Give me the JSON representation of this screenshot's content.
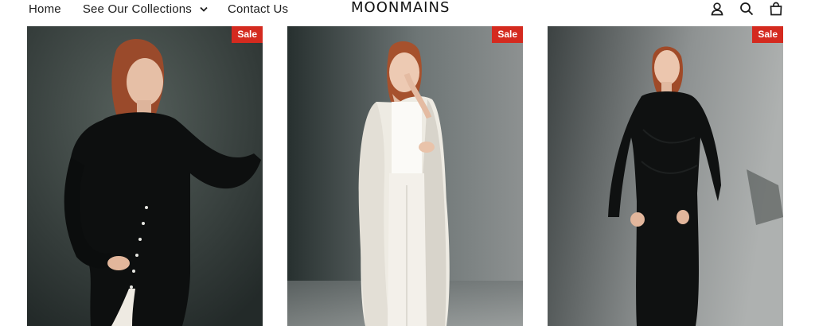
{
  "nav": {
    "home": "Home",
    "collections": "See Our Collections",
    "contact": "Contact Us"
  },
  "logo": "MOONMAINS",
  "header_icons": [
    "account-icon",
    "search-icon",
    "cart-icon"
  ],
  "products": [
    {
      "badge": "Sale",
      "image": "model in black long-sleeve dress with pearl buttons"
    },
    {
      "badge": "Sale",
      "image": "model in white cape and white trousers"
    },
    {
      "badge": "Sale",
      "image": "model in black long-sleeve ruched maxi dress"
    }
  ],
  "colors": {
    "sale_badge": "#d42a1f",
    "text": "#1c1c1c"
  }
}
